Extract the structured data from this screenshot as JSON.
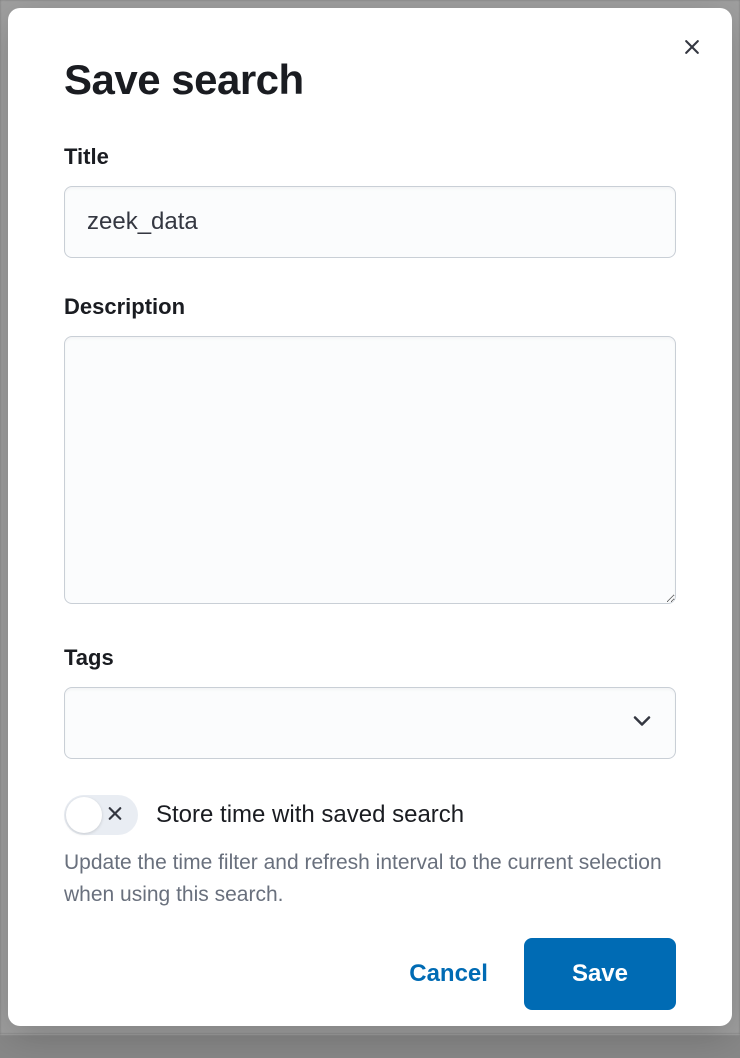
{
  "modal": {
    "title": "Save search",
    "fields": {
      "title": {
        "label": "Title",
        "value": "zeek_data"
      },
      "description": {
        "label": "Description",
        "value": ""
      },
      "tags": {
        "label": "Tags",
        "value": ""
      },
      "store_time": {
        "label": "Store time with saved search",
        "help": "Update the time filter and refresh interval to the current selection when using this search.",
        "enabled": false
      }
    },
    "buttons": {
      "cancel": "Cancel",
      "save": "Save"
    }
  }
}
